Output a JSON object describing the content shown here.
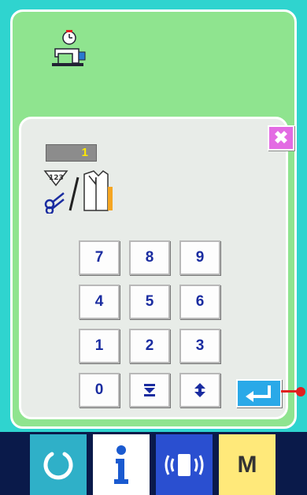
{
  "dialog": {
    "counter_value": "1",
    "close_symbol": "✖"
  },
  "keypad": {
    "rows": [
      [
        "7",
        "8",
        "9"
      ],
      [
        "4",
        "5",
        "6"
      ],
      [
        "1",
        "2",
        "3"
      ]
    ],
    "zero_label": "0",
    "down_icon": "decrement-icon",
    "up_icon": "increment-icon",
    "enter_icon": "enter-icon"
  },
  "bottom_bar": {
    "ready_icon": "ready-key-icon",
    "info_icon": "information-icon",
    "comm_icon": "communication-icon",
    "mode_label": "M"
  },
  "colors": {
    "background": "#2fd4cf",
    "screen": "#8fe48f",
    "dialog": "#e8ece8",
    "close_button": "#e36be3",
    "key_text": "#1a2ca0",
    "enter_button": "#2aa9e8",
    "counter_text": "#ffea00",
    "mode_button": "#ffe97a"
  },
  "icons": {
    "header": "sewing-machine-timer-icon",
    "field": "thread-cut-count-shirt-icon"
  }
}
